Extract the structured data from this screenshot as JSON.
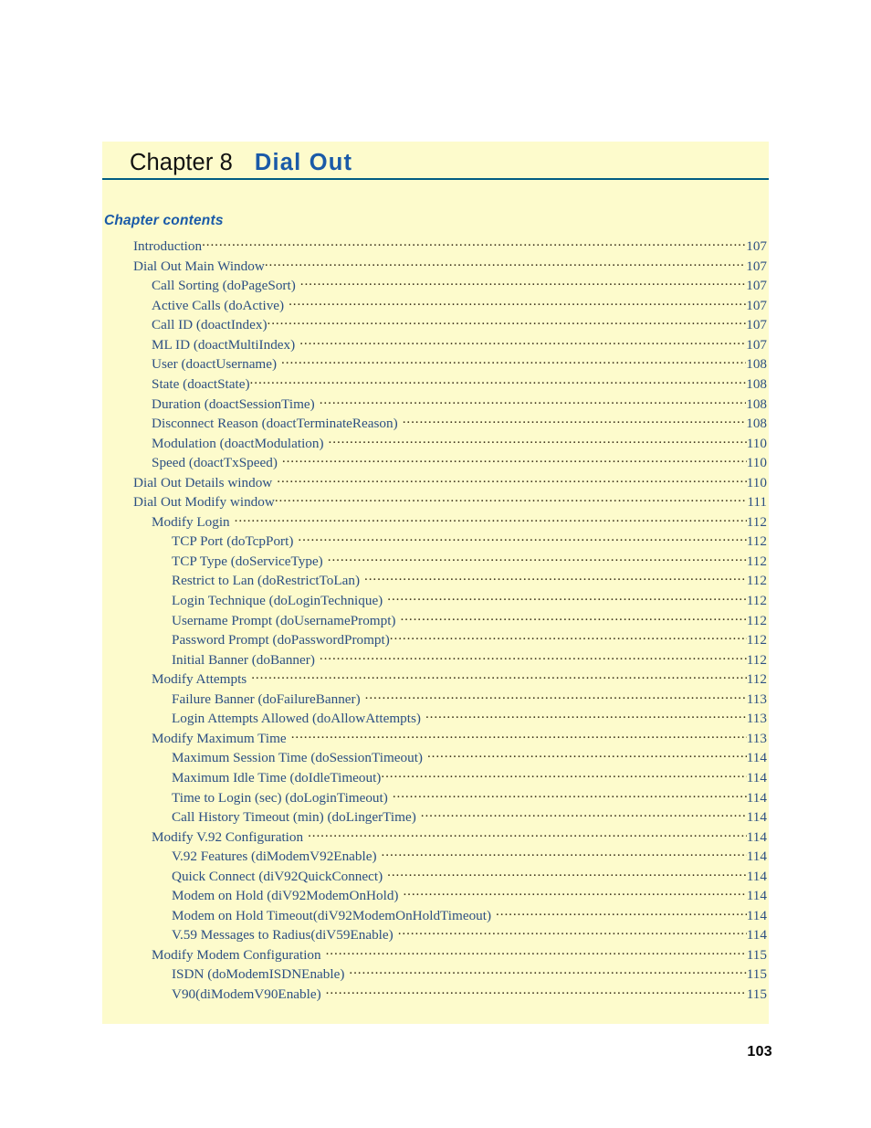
{
  "page": {
    "folio": "103",
    "background_color": "#ffffff",
    "panel_color": "#fdfbcc",
    "accent_color": "#1a5aa8",
    "rule_color": "#015c82",
    "text_color": "#2c4f83"
  },
  "chapter": {
    "label": "Chapter 8",
    "title": "Dial Out"
  },
  "contents": {
    "heading": "Chapter contents",
    "entries": [
      {
        "level": 1,
        "label": "Introduction",
        "page": "107",
        "gap": false
      },
      {
        "level": 1,
        "label": "Dial Out Main Window",
        "page": "107",
        "gap": false
      },
      {
        "level": 2,
        "label": "Call Sorting (doPageSort)",
        "page": "107",
        "gap": true
      },
      {
        "level": 2,
        "label": "Active Calls (doActive)",
        "page": "107",
        "gap": true
      },
      {
        "level": 2,
        "label": "Call ID (doactIndex)",
        "page": "107",
        "gap": false
      },
      {
        "level": 2,
        "label": "ML ID (doactMultiIndex)",
        "page": "107",
        "gap": true
      },
      {
        "level": 2,
        "label": "User (doactUsername)",
        "page": "108",
        "gap": true
      },
      {
        "level": 2,
        "label": "State (doactState)",
        "page": "108",
        "gap": false
      },
      {
        "level": 2,
        "label": "Duration (doactSessionTime)",
        "page": "108",
        "gap": true
      },
      {
        "level": 2,
        "label": "Disconnect Reason (doactTerminateReason)",
        "page": "108",
        "gap": true
      },
      {
        "level": 2,
        "label": "Modulation (doactModulation)",
        "page": "110",
        "gap": true
      },
      {
        "level": 2,
        "label": "Speed (doactTxSpeed)",
        "page": "110",
        "gap": true
      },
      {
        "level": 1,
        "label": "Dial Out Details window",
        "page": "110",
        "gap": true
      },
      {
        "level": 1,
        "label": "Dial Out Modify window",
        "page": "111",
        "gap": false
      },
      {
        "level": 2,
        "label": "Modify Login",
        "page": "112",
        "gap": true
      },
      {
        "level": 3,
        "label": "TCP Port (doTcpPort)",
        "page": "112",
        "gap": true
      },
      {
        "level": 3,
        "label": "TCP Type (doServiceType)",
        "page": "112",
        "gap": true
      },
      {
        "level": 3,
        "label": "Restrict to Lan (doRestrictToLan)",
        "page": "112",
        "gap": true
      },
      {
        "level": 3,
        "label": "Login Technique (doLoginTechnique)",
        "page": "112",
        "gap": true
      },
      {
        "level": 3,
        "label": "Username Prompt (doUsernamePrompt)",
        "page": "112",
        "gap": true
      },
      {
        "level": 3,
        "label": "Password Prompt (doPasswordPrompt)",
        "page": "112",
        "gap": false
      },
      {
        "level": 3,
        "label": "Initial Banner (doBanner)",
        "page": "112",
        "gap": true
      },
      {
        "level": 2,
        "label": "Modify Attempts",
        "page": "112",
        "gap": true
      },
      {
        "level": 3,
        "label": "Failure Banner (doFailureBanner)",
        "page": "113",
        "gap": true
      },
      {
        "level": 3,
        "label": "Login Attempts Allowed (doAllowAttempts)",
        "page": "113",
        "gap": true
      },
      {
        "level": 2,
        "label": "Modify Maximum Time",
        "page": "113",
        "gap": true
      },
      {
        "level": 3,
        "label": "Maximum Session Time (doSessionTimeout)",
        "page": "114",
        "gap": true
      },
      {
        "level": 3,
        "label": "Maximum Idle Time (doIdleTimeout)",
        "page": "114",
        "gap": false
      },
      {
        "level": 3,
        "label": "Time to Login (sec) (doLoginTimeout)",
        "page": "114",
        "gap": true
      },
      {
        "level": 3,
        "label": "Call History Timeout (min) (doLingerTime)",
        "page": "114",
        "gap": true
      },
      {
        "level": 2,
        "label": "Modify V.92 Configuration",
        "page": "114",
        "gap": true
      },
      {
        "level": 3,
        "label": "V.92 Features (diModemV92Enable)",
        "page": "114",
        "gap": true
      },
      {
        "level": 3,
        "label": "Quick Connect (diV92QuickConnect)",
        "page": "114",
        "gap": true
      },
      {
        "level": 3,
        "label": "Modem on Hold (diV92ModemOnHold)",
        "page": "114",
        "gap": true
      },
      {
        "level": 3,
        "label": "Modem on Hold Timeout(diV92ModemOnHoldTimeout)",
        "page": "114",
        "gap": true
      },
      {
        "level": 3,
        "label": "V.59 Messages to Radius(diV59Enable)",
        "page": "114",
        "gap": true
      },
      {
        "level": 2,
        "label": "Modify Modem Configuration",
        "page": "115",
        "gap": true
      },
      {
        "level": 3,
        "label": "ISDN (doModemISDNEnable)",
        "page": "115",
        "gap": true
      },
      {
        "level": 3,
        "label": "V90(diModemV90Enable)",
        "page": "115",
        "gap": true
      }
    ]
  }
}
